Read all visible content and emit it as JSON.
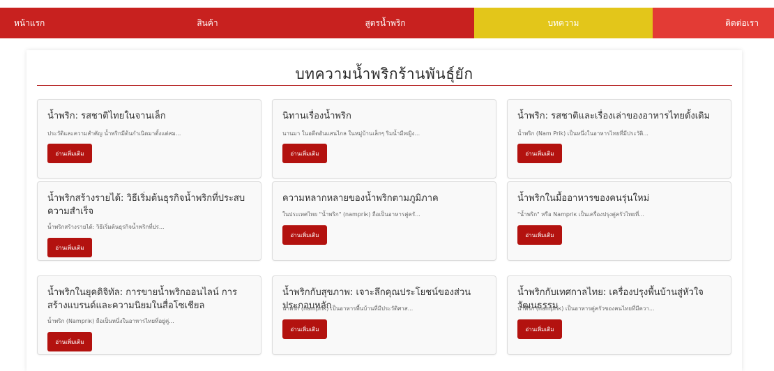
{
  "nav": {
    "colors": {
      "red": "#c8211f",
      "yellow": "#e3c61a",
      "red_light": "#e33b35"
    },
    "items": [
      {
        "label": "หน้าแรก"
      },
      {
        "label": "สินค้า"
      },
      {
        "label": "สูตรน้ำพริก"
      },
      {
        "label": "บทความ"
      },
      {
        "label": "ติดต่อเรา"
      }
    ]
  },
  "page": {
    "title": "บทความน้ำพริกร้านพันธุ์ยัก"
  },
  "articles": [
    {
      "title": "น้ำพริก: รสชาติไทยในจานเล็ก",
      "excerpt": "ประวัติและความสำคัญ น้ำพริกมีต้นกำเนิดมาตั้งแต่สม...",
      "button": "อ่านเพิ่มเติม"
    },
    {
      "title": "นิทานเรื่องน้ำพริก",
      "excerpt": "นานมา ในอดีตอันแสนไกล ในหมู่บ้านเล็กๆ ริมน้ำมีหญิง...",
      "button": "อ่านเพิ่มเติม"
    },
    {
      "title": "น้ำพริก: รสชาติและเรื่องเล่าของอาหารไทยดั้งเดิม",
      "excerpt": "น้ำพริก (Nam Prik) เป็นหนึ่งในอาหารไทยที่มีประวัติ...",
      "button": "อ่านเพิ่มเติม"
    },
    {
      "title": "น้ำพริกสร้างรายได้: วิธีเริ่มต้นธุรกิจน้ำพริกที่ประสบความสำเร็จ",
      "excerpt": "น้ำพริกสร้างรายได้: วิธีเริ่มต้นธุรกิจน้ำพริกที่ปร...",
      "button": "อ่านเพิ่มเติม"
    },
    {
      "title": "ความหลากหลายของน้ำพริกตามภูมิภาค",
      "excerpt": "ในประเทศไทย \"น้ำพริก\" (nampríк) ถือเป็นอาหารคู่ครั...",
      "button": "อ่านเพิ่มเติม"
    },
    {
      "title": "น้ำพริกในมื้ออาหารของคนรุ่นใหม่",
      "excerpt": "\"น้ำพริก\" หรือ Nampriк เป็นเครื่องปรุงคู่ครัวไทยที่...",
      "button": "อ่านเพิ่มเติม"
    },
    {
      "title": "น้ำพริกในยุคดิจิทัล: การขายน้ำพริกออนไลน์ การสร้างแบรนด์และความนิยมในสื่อโซเชียล",
      "excerpt": "น้ำพริก (Nampriк) ถือเป็นหนึ่งในอาหารไทยที่อยู่คู่...",
      "button": "อ่านเพิ่มเติม"
    },
    {
      "title": "น้ำพริกกับสุขภาพ: เจาะลึกคุณประโยชน์ของส่วนประกอบหลัก",
      "excerpt": "น้ำพริก (nampríк) เป็นอาหารพื้นบ้านที่มีประวัติศาส...",
      "button": "อ่านเพิ่มเติม"
    },
    {
      "title": "น้ำพริกกับเทศกาลไทย: เครื่องปรุงพื้นบ้านสู่หัวใจวัฒนธรรม",
      "excerpt": "น้ำพริก (nampríк) เป็นอาหารคู่ครัวของคนไทยที่มีควา...",
      "button": "อ่านเพิ่มเติม"
    }
  ]
}
